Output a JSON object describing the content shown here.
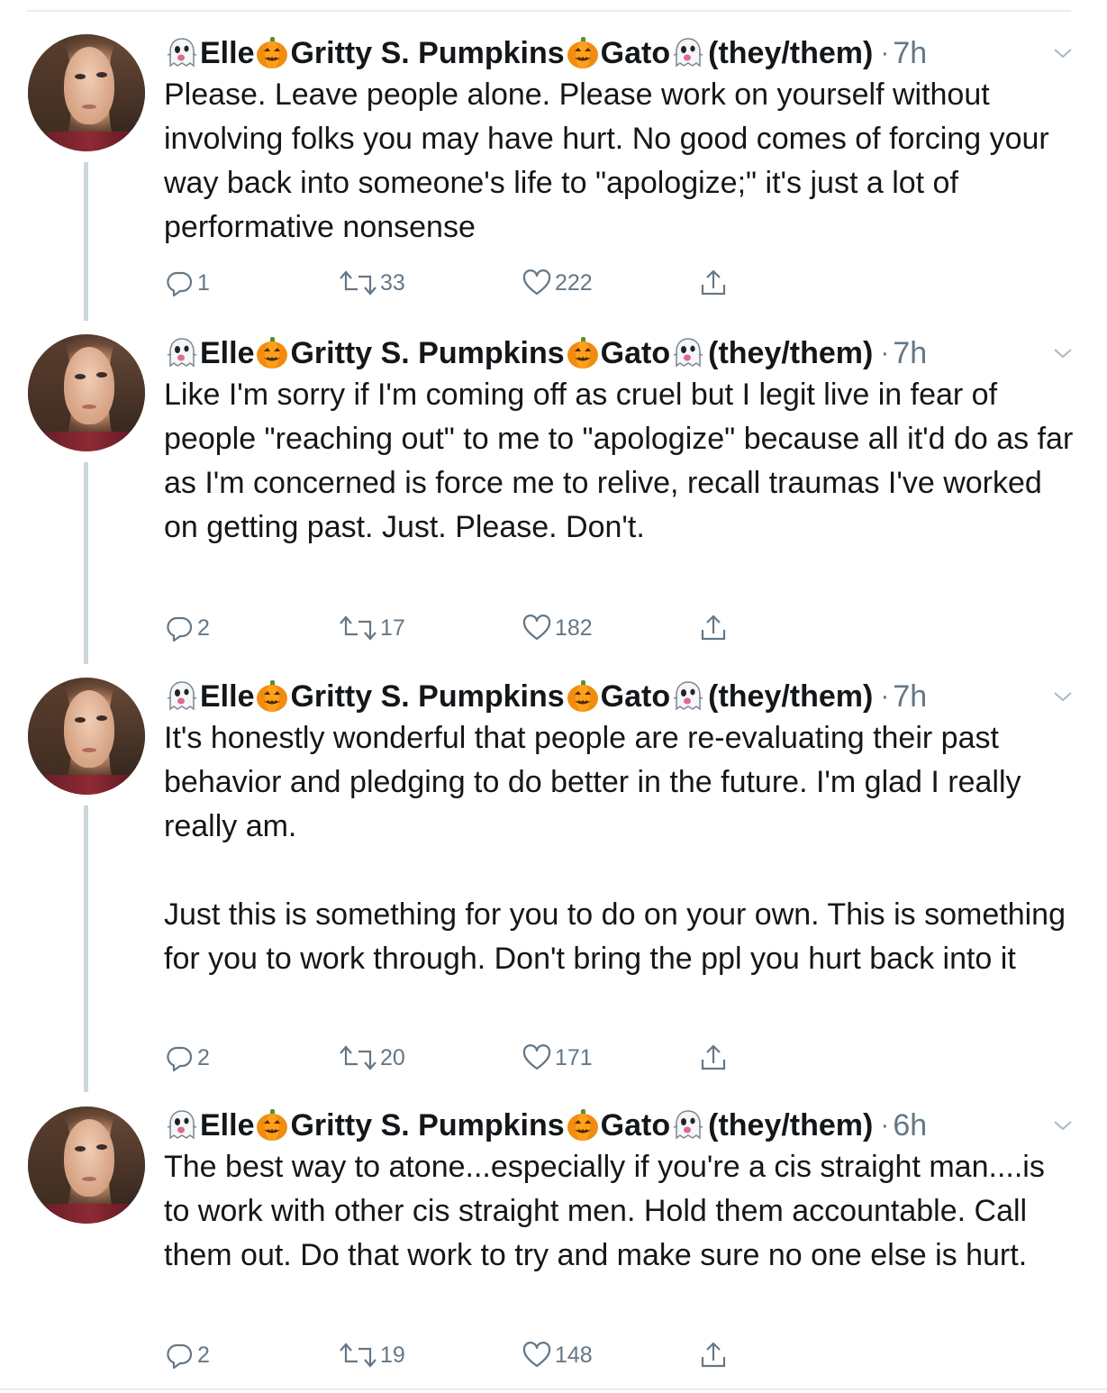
{
  "author": {
    "name_parts": [
      "Elle",
      "Gritty S. Pumpkins",
      "Gato"
    ],
    "pronouns": "(they/them)",
    "emoji": [
      "ghost-emoji",
      "pumpkin-emoji",
      "pumpkin-emoji",
      "ghost-emoji"
    ]
  },
  "tweets": [
    {
      "time": "7h",
      "text": "Please. Leave people alone. Please work on yourself without involving folks you may have hurt. No good comes of forcing your way back into someone's life to \"apologize;\" it's just a lot of performative nonsense",
      "replies": "1",
      "retweets": "33",
      "likes": "222"
    },
    {
      "time": "7h",
      "text": "Like I'm sorry if I'm coming off as cruel but I legit live in fear of people \"reaching out\" to me to \"apologize\" because all it'd do as far as I'm concerned is force me to relive, recall traumas I've worked on getting past. Just. Please. Don't.",
      "replies": "2",
      "retweets": "17",
      "likes": "182"
    },
    {
      "time": "7h",
      "text": "It's honestly wonderful that people are re-evaluating their past behavior and pledging to do better in the future. I'm glad I really really am.\n\nJust this is something for you to do on your own. This is something for you to work through. Don't bring the ppl you hurt back into it",
      "replies": "2",
      "retweets": "20",
      "likes": "171"
    },
    {
      "time": "6h",
      "text": "The best way to atone...especially if you're a cis straight man....is to work with other cis straight men. Hold them accountable. Call them out. Do that work to try and make sure no one else is hurt.",
      "replies": "2",
      "retweets": "19",
      "likes": "148"
    }
  ],
  "colors": {
    "text": "#14171a",
    "muted": "#657786",
    "thread_line": "#ccd6dd",
    "divider": "#e6ecf0"
  },
  "icons": [
    "reply-icon",
    "retweet-icon",
    "like-icon",
    "share-icon",
    "chevron-down-icon"
  ]
}
